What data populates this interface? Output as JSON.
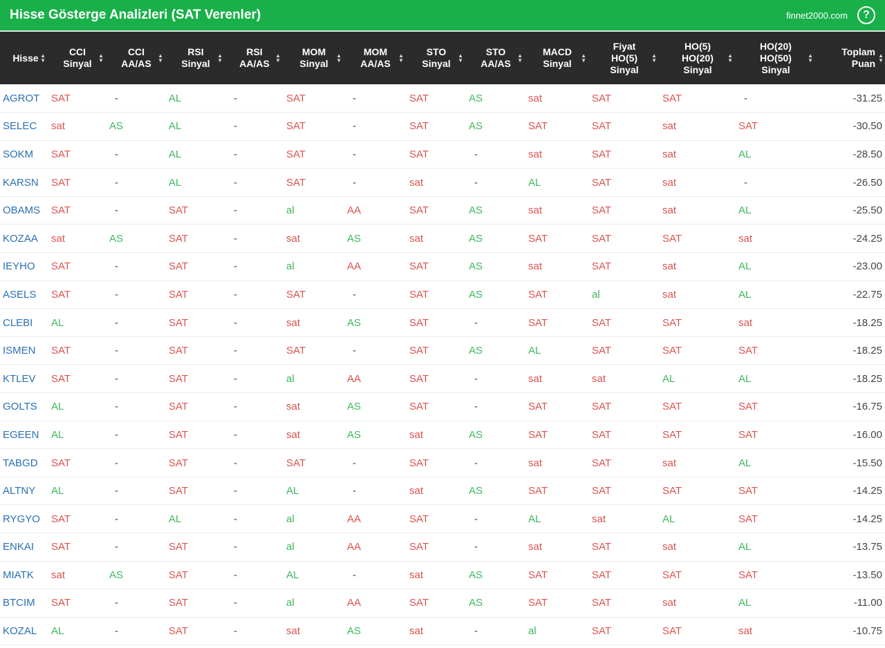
{
  "header": {
    "title": "Hisse Gösterge Analizleri (SAT Verenler)",
    "brand": "finnet2000.com",
    "help_label": "?"
  },
  "colors": {
    "green_bar": "#19b04a",
    "header_bg": "#2b2b2b",
    "sell": "#d9534f",
    "buy": "#3db75c",
    "symbol": "#2a6fb3"
  },
  "icons": {
    "help": "question-circle-icon",
    "sort": "sort-arrows-icon"
  },
  "columns": [
    {
      "line1": "Hisse",
      "line2": ""
    },
    {
      "line1": "CCI",
      "line2": "Sinyal"
    },
    {
      "line1": "CCI",
      "line2": "AA/AS"
    },
    {
      "line1": "RSI",
      "line2": "Sinyal"
    },
    {
      "line1": "RSI",
      "line2": "AA/AS"
    },
    {
      "line1": "MOM",
      "line2": "Sinyal"
    },
    {
      "line1": "MOM",
      "line2": "AA/AS"
    },
    {
      "line1": "STO",
      "line2": "Sinyal"
    },
    {
      "line1": "STO",
      "line2": "AA/AS"
    },
    {
      "line1": "MACD",
      "line2": "Sinyal"
    },
    {
      "line1": "Fiyat",
      "line2": "HO(5)",
      "line3": "Sinyal"
    },
    {
      "line1": "HO(5)",
      "line2": "HO(20)",
      "line3": "Sinyal"
    },
    {
      "line1": "HO(20)",
      "line2": "HO(50)",
      "line3": "Sinyal"
    },
    {
      "line1": "Toplam",
      "line2": "Puan"
    }
  ],
  "rows": [
    [
      "AGROT",
      "SAT",
      "-",
      "AL",
      "-",
      "SAT",
      "-",
      "SAT",
      "AS",
      "sat",
      "SAT",
      "SAT",
      "-",
      "-31.25"
    ],
    [
      "SELEC",
      "sat",
      "AS",
      "AL",
      "-",
      "SAT",
      "-",
      "SAT",
      "AS",
      "SAT",
      "SAT",
      "sat",
      "SAT",
      "-30.50"
    ],
    [
      "SOKM",
      "SAT",
      "-",
      "AL",
      "-",
      "SAT",
      "-",
      "SAT",
      "-",
      "sat",
      "SAT",
      "sat",
      "AL",
      "-28.50"
    ],
    [
      "KARSN",
      "SAT",
      "-",
      "AL",
      "-",
      "SAT",
      "-",
      "sat",
      "-",
      "AL",
      "SAT",
      "sat",
      "-",
      "-26.50"
    ],
    [
      "OBAMS",
      "SAT",
      "-",
      "SAT",
      "-",
      "al",
      "AA",
      "SAT",
      "AS",
      "sat",
      "SAT",
      "sat",
      "AL",
      "-25.50"
    ],
    [
      "KOZAA",
      "sat",
      "AS",
      "SAT",
      "-",
      "sat",
      "AS",
      "sat",
      "AS",
      "SAT",
      "SAT",
      "SAT",
      "sat",
      "-24.25"
    ],
    [
      "IEYHO",
      "SAT",
      "-",
      "SAT",
      "-",
      "al",
      "AA",
      "SAT",
      "AS",
      "sat",
      "SAT",
      "sat",
      "AL",
      "-23.00"
    ],
    [
      "ASELS",
      "SAT",
      "-",
      "SAT",
      "-",
      "SAT",
      "-",
      "SAT",
      "AS",
      "SAT",
      "al",
      "sat",
      "AL",
      "-22.75"
    ],
    [
      "CLEBI",
      "AL",
      "-",
      "SAT",
      "-",
      "sat",
      "AS",
      "SAT",
      "-",
      "SAT",
      "SAT",
      "SAT",
      "sat",
      "-18.25"
    ],
    [
      "ISMEN",
      "SAT",
      "-",
      "SAT",
      "-",
      "SAT",
      "-",
      "SAT",
      "AS",
      "AL",
      "SAT",
      "SAT",
      "SAT",
      "-18.25"
    ],
    [
      "KTLEV",
      "SAT",
      "-",
      "SAT",
      "-",
      "al",
      "AA",
      "SAT",
      "-",
      "sat",
      "sat",
      "AL",
      "AL",
      "-18.25"
    ],
    [
      "GOLTS",
      "AL",
      "-",
      "SAT",
      "-",
      "sat",
      "AS",
      "SAT",
      "-",
      "SAT",
      "SAT",
      "SAT",
      "SAT",
      "-16.75"
    ],
    [
      "EGEEN",
      "AL",
      "-",
      "SAT",
      "-",
      "sat",
      "AS",
      "sat",
      "AS",
      "SAT",
      "SAT",
      "SAT",
      "SAT",
      "-16.00"
    ],
    [
      "TABGD",
      "SAT",
      "-",
      "SAT",
      "-",
      "SAT",
      "-",
      "SAT",
      "-",
      "sat",
      "SAT",
      "sat",
      "AL",
      "-15.50"
    ],
    [
      "ALTNY",
      "AL",
      "-",
      "SAT",
      "-",
      "AL",
      "-",
      "sat",
      "AS",
      "SAT",
      "SAT",
      "SAT",
      "SAT",
      "-14.25"
    ],
    [
      "RYGYO",
      "SAT",
      "-",
      "AL",
      "-",
      "al",
      "AA",
      "SAT",
      "-",
      "AL",
      "sat",
      "AL",
      "SAT",
      "-14.25"
    ],
    [
      "ENKAI",
      "SAT",
      "-",
      "SAT",
      "-",
      "al",
      "AA",
      "SAT",
      "-",
      "sat",
      "SAT",
      "sat",
      "AL",
      "-13.75"
    ],
    [
      "MIATK",
      "sat",
      "AS",
      "SAT",
      "-",
      "AL",
      "-",
      "sat",
      "AS",
      "SAT",
      "SAT",
      "SAT",
      "SAT",
      "-13.50"
    ],
    [
      "BTCIM",
      "SAT",
      "-",
      "SAT",
      "-",
      "al",
      "AA",
      "SAT",
      "AS",
      "SAT",
      "SAT",
      "sat",
      "AL",
      "-11.00"
    ],
    [
      "KOZAL",
      "AL",
      "-",
      "SAT",
      "-",
      "sat",
      "AS",
      "sat",
      "-",
      "al",
      "SAT",
      "SAT",
      "sat",
      "-10.75"
    ]
  ]
}
